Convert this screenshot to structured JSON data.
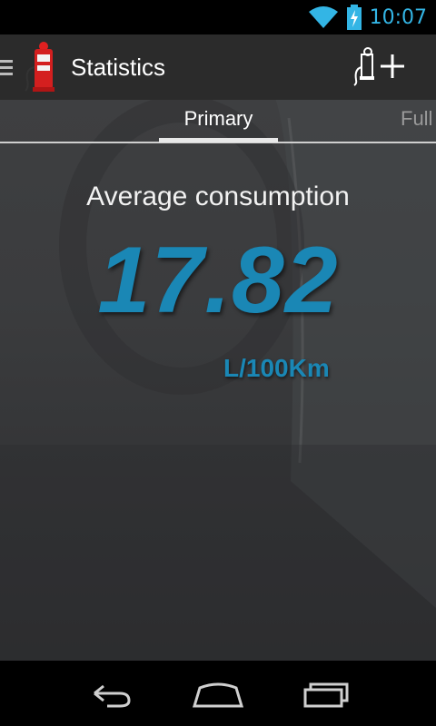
{
  "status_bar": {
    "time": "10:07",
    "accent_color": "#33b5e5"
  },
  "action_bar": {
    "title": "Statistics",
    "icons": [
      "drawer-icon",
      "fuel-pump-icon",
      "add-refuel-icon"
    ]
  },
  "tabs": [
    {
      "label": "Primary",
      "selected": true
    },
    {
      "label": "Full",
      "selected": false
    }
  ],
  "stats": {
    "label": "Average consumption",
    "value": "17.82",
    "unit": "L/100Km",
    "value_color": "#1a87b5"
  },
  "nav_bar": {
    "icons": [
      "back-icon",
      "home-icon",
      "recents-icon"
    ]
  }
}
